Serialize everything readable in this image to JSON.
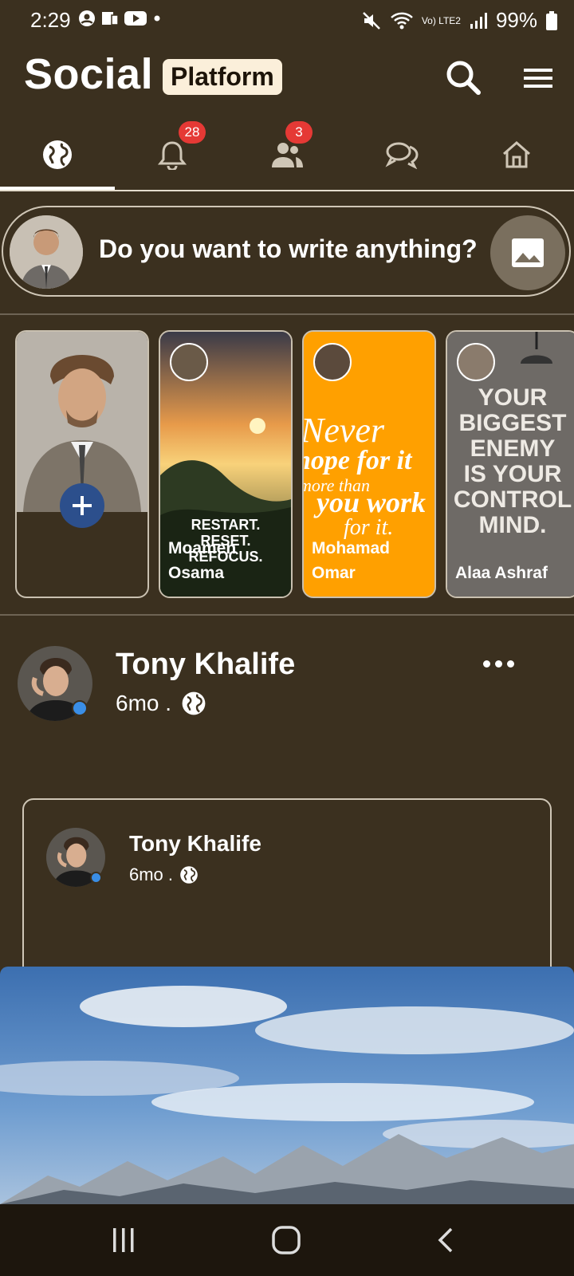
{
  "status_bar": {
    "time": "2:29",
    "battery": "99%",
    "network": "Vo) LTE2"
  },
  "app_bar": {
    "title": "Social",
    "title_badge": "Platform"
  },
  "tabs": [
    {
      "name": "feed",
      "icon": "globe-icon",
      "selected": true
    },
    {
      "name": "notifications",
      "icon": "bell-icon",
      "count": "28"
    },
    {
      "name": "friend-requests",
      "icon": "people-icon",
      "count": "3"
    },
    {
      "name": "messages",
      "icon": "chat-icon"
    },
    {
      "name": "home",
      "icon": "home-icon"
    }
  ],
  "composer": {
    "placeholder": "Do you want to write anything?"
  },
  "stories": [
    {
      "name": "",
      "type": "add-story"
    },
    {
      "name": "Moamen Osama",
      "image_text": "RESTART. RESET. REFOCUS."
    },
    {
      "name": "Mohamad Omar",
      "image_text": "Never hope for it more than you work for it."
    },
    {
      "name": "Alaa Ashraf",
      "image_text": "YOUR BIGGEST ENEMY IS YOUR CONTROL MIND."
    }
  ],
  "post": {
    "author": "Tony Khalife",
    "time": "6mo .",
    "shared": {
      "author": "Tony Khalife",
      "time": "6mo ."
    }
  },
  "colors": {
    "background": "#3b301f",
    "badge": "#e53935",
    "accent": "#2c4f8c",
    "story_orange": "#ffa000",
    "online": "#3a8ee6"
  }
}
